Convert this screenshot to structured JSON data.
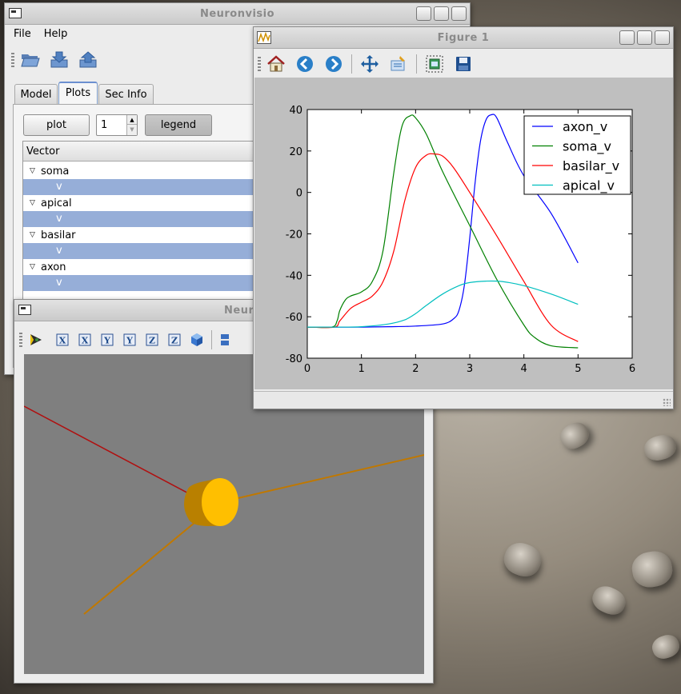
{
  "main_window": {
    "title": "Neuronvisio",
    "menu": [
      "File",
      "Help"
    ],
    "toolbar_icons": [
      "open-folder-icon",
      "import-icon",
      "export-icon"
    ],
    "tabs": [
      {
        "label": "Model",
        "active": false
      },
      {
        "label": "Plots",
        "active": true
      },
      {
        "label": "Sec Info",
        "active": false
      }
    ],
    "plot_button": "plot",
    "spin_value": "1",
    "legend_button": "legend",
    "tree_header": "Vector",
    "tree_items": [
      {
        "section": "soma",
        "child": "v"
      },
      {
        "section": "apical",
        "child": "v"
      },
      {
        "section": "basilar",
        "child": "v"
      },
      {
        "section": "axon",
        "child": "v"
      }
    ]
  },
  "window_3d": {
    "title": "Neuronvisio 3D",
    "toolbar_icons": [
      "pick-icon",
      "x-view-icon",
      "x-view-reverse-icon",
      "y-view-icon",
      "y-view-reverse-icon",
      "z-view-icon",
      "z-view-reverse-icon",
      "cube-icon",
      "layout-icon"
    ],
    "axis_labels": [
      "X",
      "X",
      "Y",
      "Y",
      "Z",
      "Z"
    ],
    "colors": {
      "background": "#7f7f7f",
      "soma": "#ffbf00",
      "dendrite_orange": "#c07800",
      "dendrite_red": "#b01010"
    }
  },
  "figure_window": {
    "title": "Figure 1",
    "toolbar_icons": [
      "home-icon",
      "back-icon",
      "forward-icon",
      "pan-icon",
      "configure-subplots-icon",
      "zoom-to-rect-icon",
      "save-icon"
    ]
  },
  "chart_data": {
    "type": "line",
    "title": "",
    "xlabel": "",
    "ylabel": "",
    "xlim": [
      0,
      6
    ],
    "ylim": [
      -80,
      40
    ],
    "xticks": [
      0,
      1,
      2,
      3,
      4,
      5,
      6
    ],
    "yticks": [
      40,
      20,
      0,
      -20,
      -40,
      -60,
      -80
    ],
    "grid": false,
    "legend_position": "top-right",
    "series": [
      {
        "name": "axon_v",
        "color": "#0000ff",
        "x": [
          0,
          0.5,
          1,
          1.5,
          2,
          2.5,
          2.7,
          2.8,
          2.9,
          3.0,
          3.1,
          3.2,
          3.3,
          3.4,
          3.5,
          3.7,
          4.0,
          4.5,
          5.0
        ],
        "y": [
          -65,
          -65,
          -65,
          -64.8,
          -64.5,
          -63.5,
          -61,
          -57,
          -45,
          -22,
          5,
          25,
          35,
          37.5,
          36,
          24,
          8,
          -10,
          -34
        ]
      },
      {
        "name": "soma_v",
        "color": "#008000",
        "x": [
          0,
          0.45,
          0.55,
          0.6,
          0.7,
          0.8,
          1.0,
          1.2,
          1.4,
          1.6,
          1.75,
          1.9,
          2.0,
          2.2,
          2.5,
          3.0,
          3.5,
          4.0,
          4.2,
          4.5,
          5.0
        ],
        "y": [
          -65,
          -65,
          -62,
          -57,
          -52,
          -50,
          -48,
          -43,
          -28,
          10,
          32,
          37,
          36,
          28,
          10,
          -16,
          -42,
          -64,
          -70,
          -74,
          -75
        ]
      },
      {
        "name": "basilar_v",
        "color": "#ff0000",
        "x": [
          0,
          0.5,
          0.6,
          0.8,
          1.0,
          1.2,
          1.4,
          1.6,
          1.8,
          2.0,
          2.2,
          2.35,
          2.5,
          2.7,
          3.0,
          3.5,
          4.0,
          4.5,
          5.0
        ],
        "y": [
          -65,
          -65,
          -62,
          -56,
          -53,
          -50,
          -43,
          -28,
          -4,
          12,
          18,
          18.5,
          17.5,
          12,
          0,
          -21,
          -43,
          -64,
          -72
        ]
      },
      {
        "name": "apical_v",
        "color": "#00bfbf",
        "x": [
          0,
          0.5,
          1,
          1.5,
          1.8,
          2.0,
          2.2,
          2.5,
          2.8,
          3.0,
          3.3,
          3.6,
          4.0,
          4.5,
          5.0
        ],
        "y": [
          -65,
          -65,
          -64.8,
          -63.5,
          -61.5,
          -58.5,
          -54.5,
          -49,
          -45,
          -43.5,
          -42.8,
          -43,
          -45,
          -49,
          -54
        ]
      }
    ]
  }
}
